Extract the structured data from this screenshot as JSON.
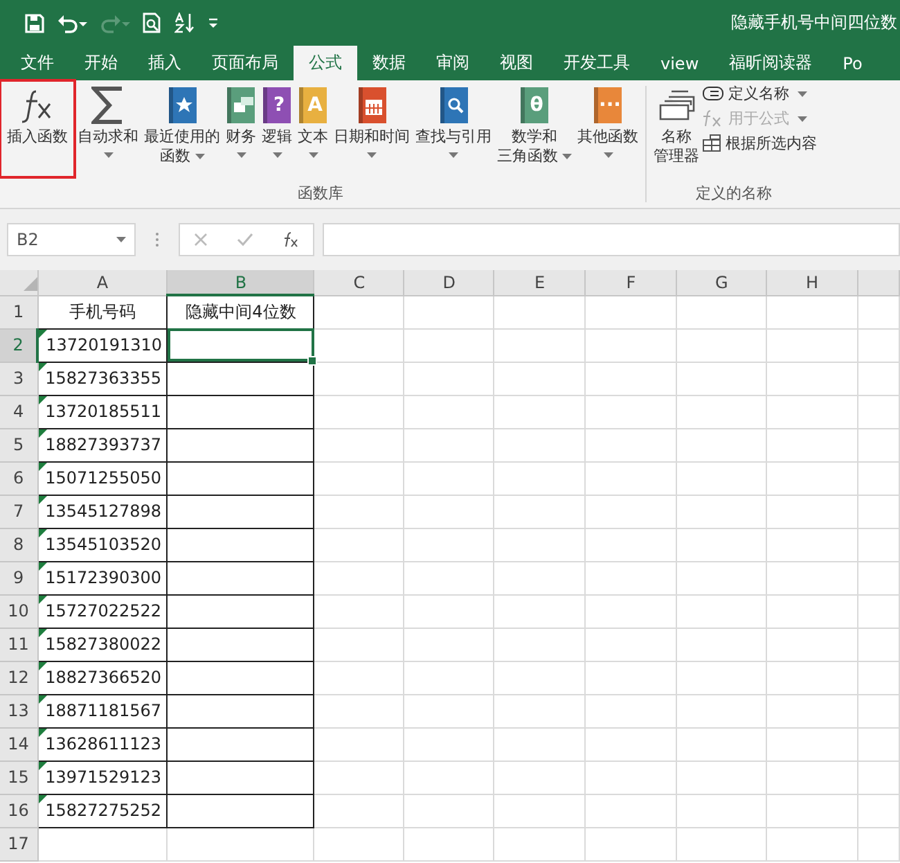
{
  "window": {
    "title": "隐藏手机号中间四位数"
  },
  "quick_access": [
    {
      "kind": "save",
      "disabled": false
    },
    {
      "kind": "undo",
      "disabled": false
    },
    {
      "kind": "redo",
      "disabled": true
    },
    {
      "kind": "preview",
      "disabled": false
    },
    {
      "kind": "sort",
      "disabled": false
    },
    {
      "kind": "customize",
      "disabled": false
    }
  ],
  "tabs": [
    {
      "label": "文件",
      "selected": false
    },
    {
      "label": "开始",
      "selected": false
    },
    {
      "label": "插入",
      "selected": false
    },
    {
      "label": "页面布局",
      "selected": false
    },
    {
      "label": "公式",
      "selected": true
    },
    {
      "label": "数据",
      "selected": false
    },
    {
      "label": "审阅",
      "selected": false
    },
    {
      "label": "视图",
      "selected": false
    },
    {
      "label": "开发工具",
      "selected": false
    },
    {
      "label": "view",
      "selected": false
    },
    {
      "label": "福昕阅读器",
      "selected": false
    },
    {
      "label": "Po",
      "selected": false
    }
  ],
  "ribbon": {
    "groups": [
      {
        "title": "函数库",
        "buttons": [
          {
            "kind": "fx",
            "lines": [
              "插入函数"
            ],
            "dropdown": false,
            "highlighted": true
          },
          {
            "kind": "sigma",
            "lines": [
              "自动求和"
            ],
            "dropdown": true,
            "highlighted": false
          },
          {
            "kind": "star-book",
            "color": "#2e75b6",
            "lines": [
              "最近使用的",
              "函数"
            ],
            "dropdown": true,
            "highlighted": false
          },
          {
            "kind": "ledger-book",
            "color": "#5a9e7c",
            "lines": [
              "财务"
            ],
            "dropdown": true,
            "highlighted": false
          },
          {
            "kind": "book",
            "glyph": "?",
            "color": "#8e4fb3",
            "lines": [
              "逻辑"
            ],
            "dropdown": true,
            "highlighted": false
          },
          {
            "kind": "book",
            "glyph": "A",
            "color": "#e8b040",
            "lines": [
              "文本"
            ],
            "dropdown": true,
            "highlighted": false
          },
          {
            "kind": "calendar-book",
            "color": "#d9502e",
            "lines": [
              "日期和时间"
            ],
            "dropdown": true,
            "highlighted": false
          },
          {
            "kind": "search-book",
            "color": "#2e75b6",
            "lines": [
              "查找与引用"
            ],
            "dropdown": true,
            "highlighted": false
          },
          {
            "kind": "book",
            "glyph": "θ",
            "color": "#5a9e7c",
            "lines": [
              "数学和",
              "三角函数"
            ],
            "dropdown": true,
            "highlighted": false
          },
          {
            "kind": "book",
            "glyph": "···",
            "color": "#e8873a",
            "lines": [
              "其他函数"
            ],
            "dropdown": true,
            "highlighted": false
          }
        ]
      },
      {
        "title": "定义的名称",
        "buttons": [
          {
            "kind": "names",
            "lines": [
              "名称",
              "管理器"
            ],
            "dropdown": false,
            "highlighted": false
          }
        ],
        "small_buttons": [
          {
            "kind": "tag",
            "label": "定义名称",
            "dropdown": true,
            "disabled": false
          },
          {
            "kind": "formula",
            "label": "用于公式",
            "dropdown": true,
            "disabled": true
          },
          {
            "kind": "table",
            "label": "根据所选内容",
            "dropdown": false,
            "disabled": false
          }
        ]
      }
    ]
  },
  "formula_bar": {
    "name_box": "B2"
  },
  "sheet": {
    "columns": [
      {
        "label": "A",
        "selected": false
      },
      {
        "label": "B",
        "selected": true
      },
      {
        "label": "C",
        "selected": false
      },
      {
        "label": "D",
        "selected": false
      },
      {
        "label": "E",
        "selected": false
      },
      {
        "label": "F",
        "selected": false
      },
      {
        "label": "G",
        "selected": false
      },
      {
        "label": "H",
        "selected": false
      }
    ],
    "rows": [
      {
        "label": "1",
        "selected": false,
        "cells": [
          {
            "text": "手机号码",
            "flag": false
          },
          {
            "text": "隐藏中间4位数",
            "flag": false
          }
        ]
      },
      {
        "label": "2",
        "selected": true,
        "cells": [
          {
            "text": "13720191310",
            "flag": true
          }
        ]
      },
      {
        "label": "3",
        "selected": false,
        "cells": [
          {
            "text": "15827363355",
            "flag": true
          }
        ]
      },
      {
        "label": "4",
        "selected": false,
        "cells": [
          {
            "text": "13720185511",
            "flag": true
          }
        ]
      },
      {
        "label": "5",
        "selected": false,
        "cells": [
          {
            "text": "18827393737",
            "flag": true
          }
        ]
      },
      {
        "label": "6",
        "selected": false,
        "cells": [
          {
            "text": "15071255050",
            "flag": true
          }
        ]
      },
      {
        "label": "7",
        "selected": false,
        "cells": [
          {
            "text": "13545127898",
            "flag": true
          }
        ]
      },
      {
        "label": "8",
        "selected": false,
        "cells": [
          {
            "text": "13545103520",
            "flag": true
          }
        ]
      },
      {
        "label": "9",
        "selected": false,
        "cells": [
          {
            "text": "15172390300",
            "flag": true
          }
        ]
      },
      {
        "label": "10",
        "selected": false,
        "cells": [
          {
            "text": "15727022522",
            "flag": true
          }
        ]
      },
      {
        "label": "11",
        "selected": false,
        "cells": [
          {
            "text": "15827380022",
            "flag": true
          }
        ]
      },
      {
        "label": "12",
        "selected": false,
        "cells": [
          {
            "text": "18827366520",
            "flag": true
          }
        ]
      },
      {
        "label": "13",
        "selected": false,
        "cells": [
          {
            "text": "18871181567",
            "flag": true
          }
        ]
      },
      {
        "label": "14",
        "selected": false,
        "cells": [
          {
            "text": "13628611123",
            "flag": true
          }
        ]
      },
      {
        "label": "15",
        "selected": false,
        "cells": [
          {
            "text": "13971529123",
            "flag": true
          }
        ]
      },
      {
        "label": "16",
        "selected": false,
        "cells": [
          {
            "text": "15827275252",
            "flag": true
          }
        ]
      },
      {
        "label": "17",
        "selected": false,
        "cells": []
      }
    ]
  }
}
